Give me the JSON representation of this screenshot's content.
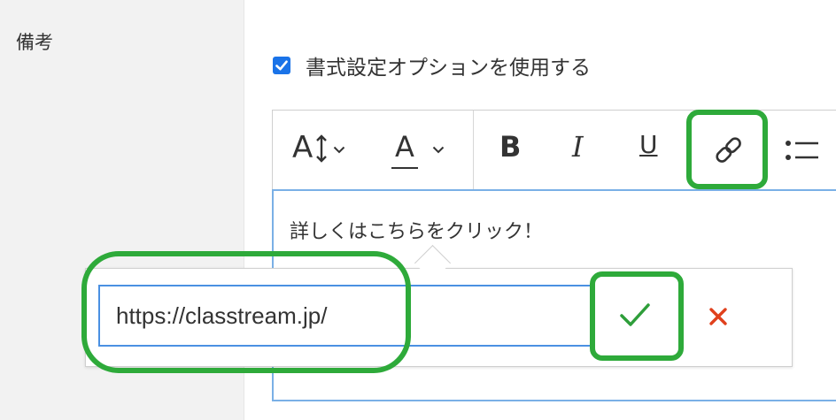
{
  "form": {
    "field_label": "備考",
    "format_option_label": "書式設定オプションを使用する",
    "format_option_checked": true
  },
  "toolbar": {
    "font_size_label": "A",
    "font_color_label": "A",
    "bold_label": "B",
    "italic_label": "I",
    "underline_label": "U",
    "icons": [
      "font-size-icon",
      "font-color-icon",
      "bold-icon",
      "italic-icon",
      "underline-icon",
      "link-icon",
      "bullet-list-icon"
    ]
  },
  "editor": {
    "content": "詳しくはこちらをクリック！"
  },
  "link_popup": {
    "url_value": "https://classtream.jp/",
    "confirm_icon": "checkmark-icon",
    "cancel_icon": "close-icon"
  },
  "colors": {
    "checkbox": "#1a73e8",
    "highlight": "#2eaa3a",
    "confirm": "#2e9e3a",
    "cancel": "#e0401c",
    "focus_border": "#4a90e2"
  }
}
